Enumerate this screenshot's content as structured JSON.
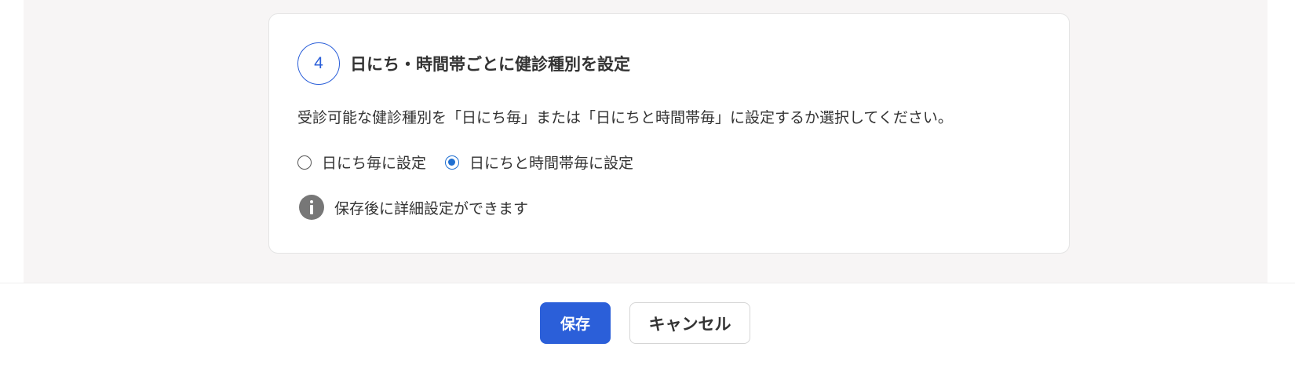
{
  "section": {
    "step_number": "4",
    "title": "日にち・時間帯ごとに健診種別を設定",
    "description": "受診可能な健診種別を「日にち毎」または「日にちと時間帯毎」に設定するか選択してください。",
    "options": [
      {
        "label": "日にち毎に設定",
        "selected": false
      },
      {
        "label": "日にちと時間帯毎に設定",
        "selected": true
      }
    ],
    "info_icon": "info-circle-icon",
    "info_text": "保存後に詳細設定ができます"
  },
  "footer": {
    "save_label": "保存",
    "cancel_label": "キャンセル"
  },
  "colors": {
    "accent": "#2b5fd9",
    "radio_selected": "#1f6fd1",
    "info_icon": "#777777",
    "background": "#f7f5f5"
  }
}
